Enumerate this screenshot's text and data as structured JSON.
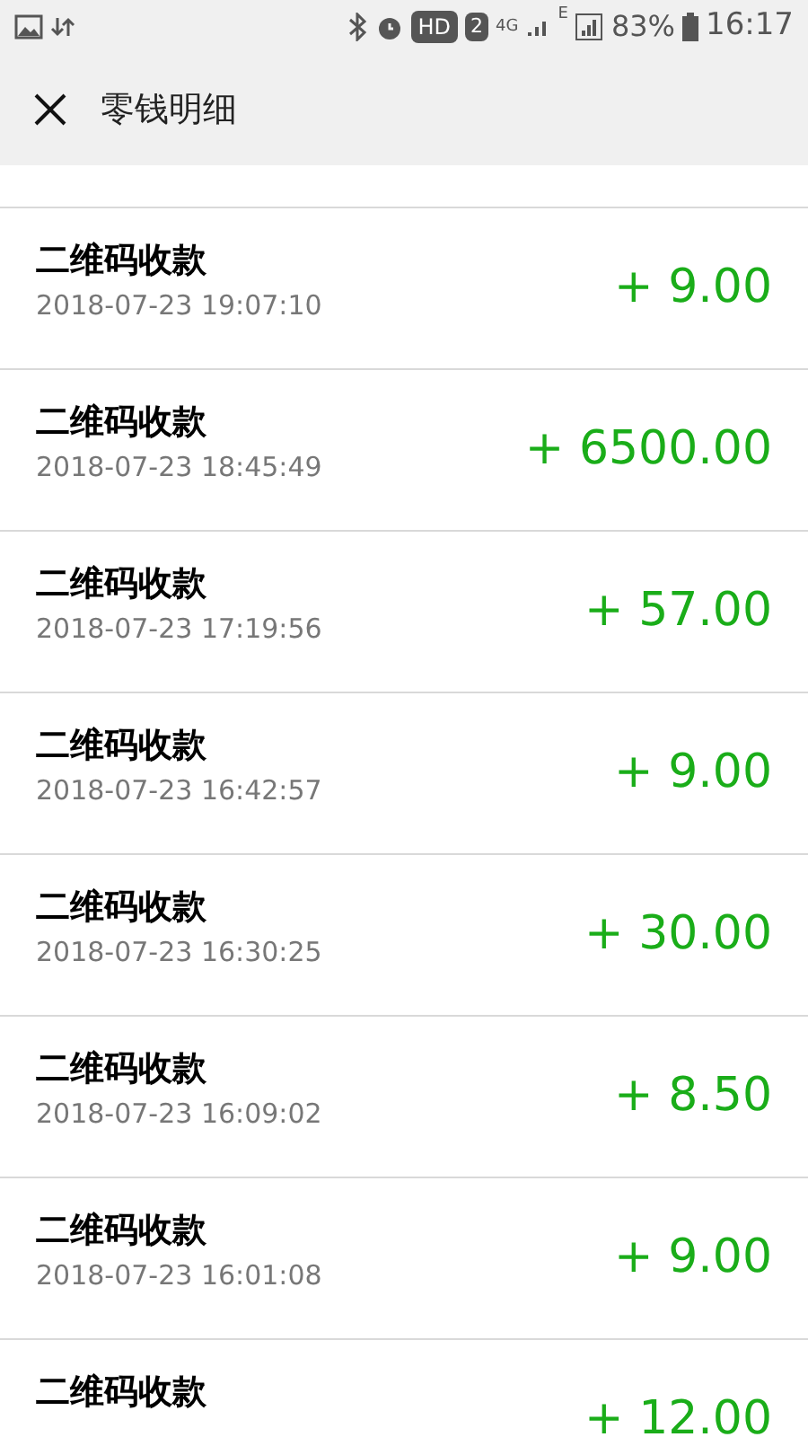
{
  "status_bar": {
    "hd": "HD",
    "sim": "2",
    "network": "4G",
    "network_2": "E",
    "battery": "83%",
    "time": "16:17"
  },
  "header": {
    "title": "零钱明细"
  },
  "records": [
    {
      "title": "二维码收款",
      "time": "2018-07-23 19:07:10",
      "amount": "+ 9.00"
    },
    {
      "title": "二维码收款",
      "time": "2018-07-23 18:45:49",
      "amount": "+ 6500.00"
    },
    {
      "title": "二维码收款",
      "time": "2018-07-23 17:19:56",
      "amount": "+ 57.00"
    },
    {
      "title": "二维码收款",
      "time": "2018-07-23 16:42:57",
      "amount": "+ 9.00"
    },
    {
      "title": "二维码收款",
      "time": "2018-07-23 16:30:25",
      "amount": "+ 30.00"
    },
    {
      "title": "二维码收款",
      "time": "2018-07-23 16:09:02",
      "amount": "+ 8.50"
    },
    {
      "title": "二维码收款",
      "time": "2018-07-23 16:01:08",
      "amount": "+ 9.00"
    },
    {
      "title": "二维码收款",
      "amount": "+ 12.00"
    }
  ]
}
